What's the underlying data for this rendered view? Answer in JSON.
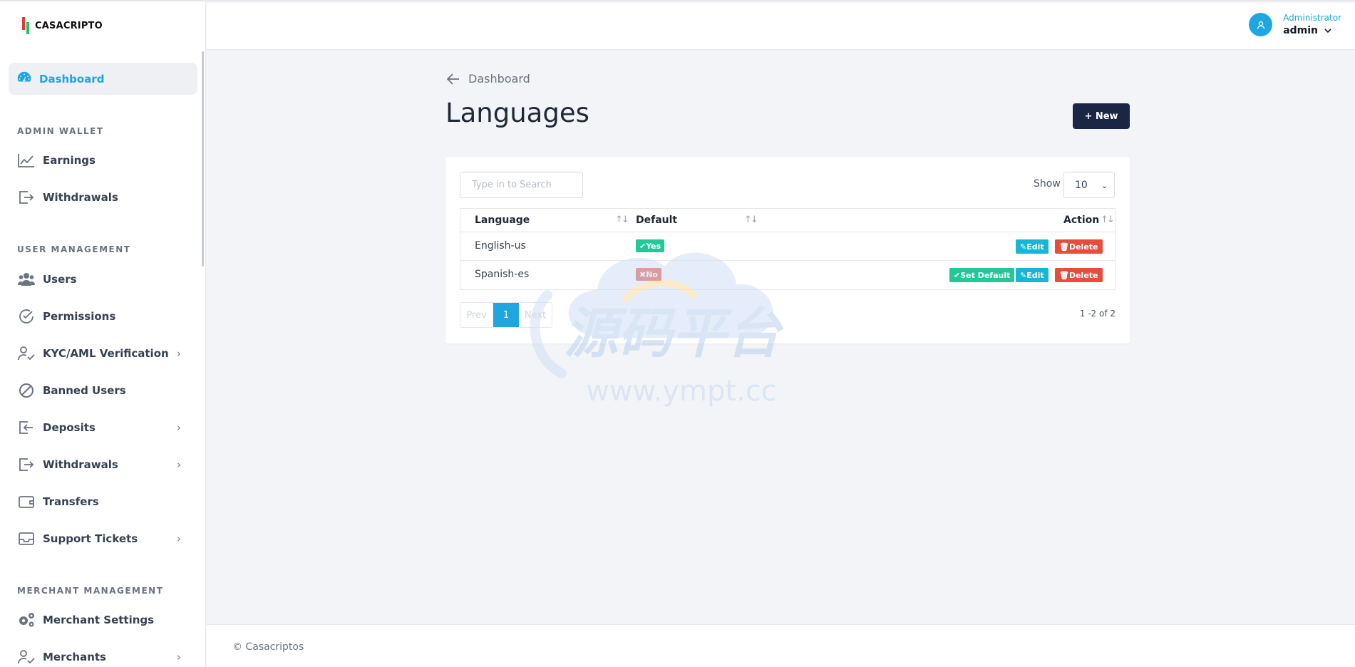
{
  "brand": {
    "name": "CASACRIPTO"
  },
  "sidebar": {
    "active": {
      "label": "Dashboard",
      "icon": "dashboard-gauge-icon"
    },
    "sections": {
      "admin_wallet": "ADMIN WALLET",
      "user_management": "USER MANAGEMENT",
      "merchant_management": "MERCHANT MANAGEMENT"
    },
    "items": [
      {
        "label": "Earnings",
        "icon": "chart-line-icon"
      },
      {
        "label": "Withdrawals",
        "icon": "exit-icon"
      },
      {
        "label": "Users",
        "icon": "users-icon"
      },
      {
        "label": "Permissions",
        "icon": "check-circle-icon"
      },
      {
        "label": "KYC/AML Verification",
        "icon": "user-check-icon",
        "chevron": "›"
      },
      {
        "label": "Banned Users",
        "icon": "ban-icon"
      },
      {
        "label": "Deposits",
        "icon": "deposit-icon",
        "chevron": "›"
      },
      {
        "label": "Withdrawals",
        "icon": "exit-icon",
        "chevron": "›"
      },
      {
        "label": "Transfers",
        "icon": "wallet-icon"
      },
      {
        "label": "Support Tickets",
        "icon": "inbox-icon",
        "chevron": "›"
      },
      {
        "label": "Merchant Settings",
        "icon": "gears-icon"
      },
      {
        "label": "Merchants",
        "icon": "user-check-icon",
        "chevron": "›"
      }
    ]
  },
  "header": {
    "role": "Administrator",
    "username": "admin"
  },
  "main": {
    "back_label": "Dashboard",
    "title": "Languages",
    "new_button": "+ New",
    "search_placeholder": "Type in to Search",
    "show_label": "Show",
    "show_value": "10",
    "table": {
      "columns": [
        "Language",
        "Default",
        "Action"
      ],
      "rows": [
        {
          "language": "English-us",
          "default": "Yes",
          "actions": [
            "Edit",
            "Delete"
          ]
        },
        {
          "language": "Spanish-es",
          "default": "No",
          "actions": [
            "Set Default",
            "Edit",
            "Delete"
          ]
        }
      ]
    },
    "pagination": {
      "prev": "Prev",
      "current": "1",
      "next": "Next",
      "summary": "1 -2 of 2"
    }
  },
  "watermark": {
    "cn": "源码平台",
    "url": "www.ympt.cc"
  },
  "footer": {
    "text": "© Casacriptos"
  },
  "colors": {
    "accent": "#1fa5e0",
    "navy": "#1a2744",
    "success": "#20c997",
    "danger": "#e74c3c",
    "info": "#17b6d4"
  }
}
